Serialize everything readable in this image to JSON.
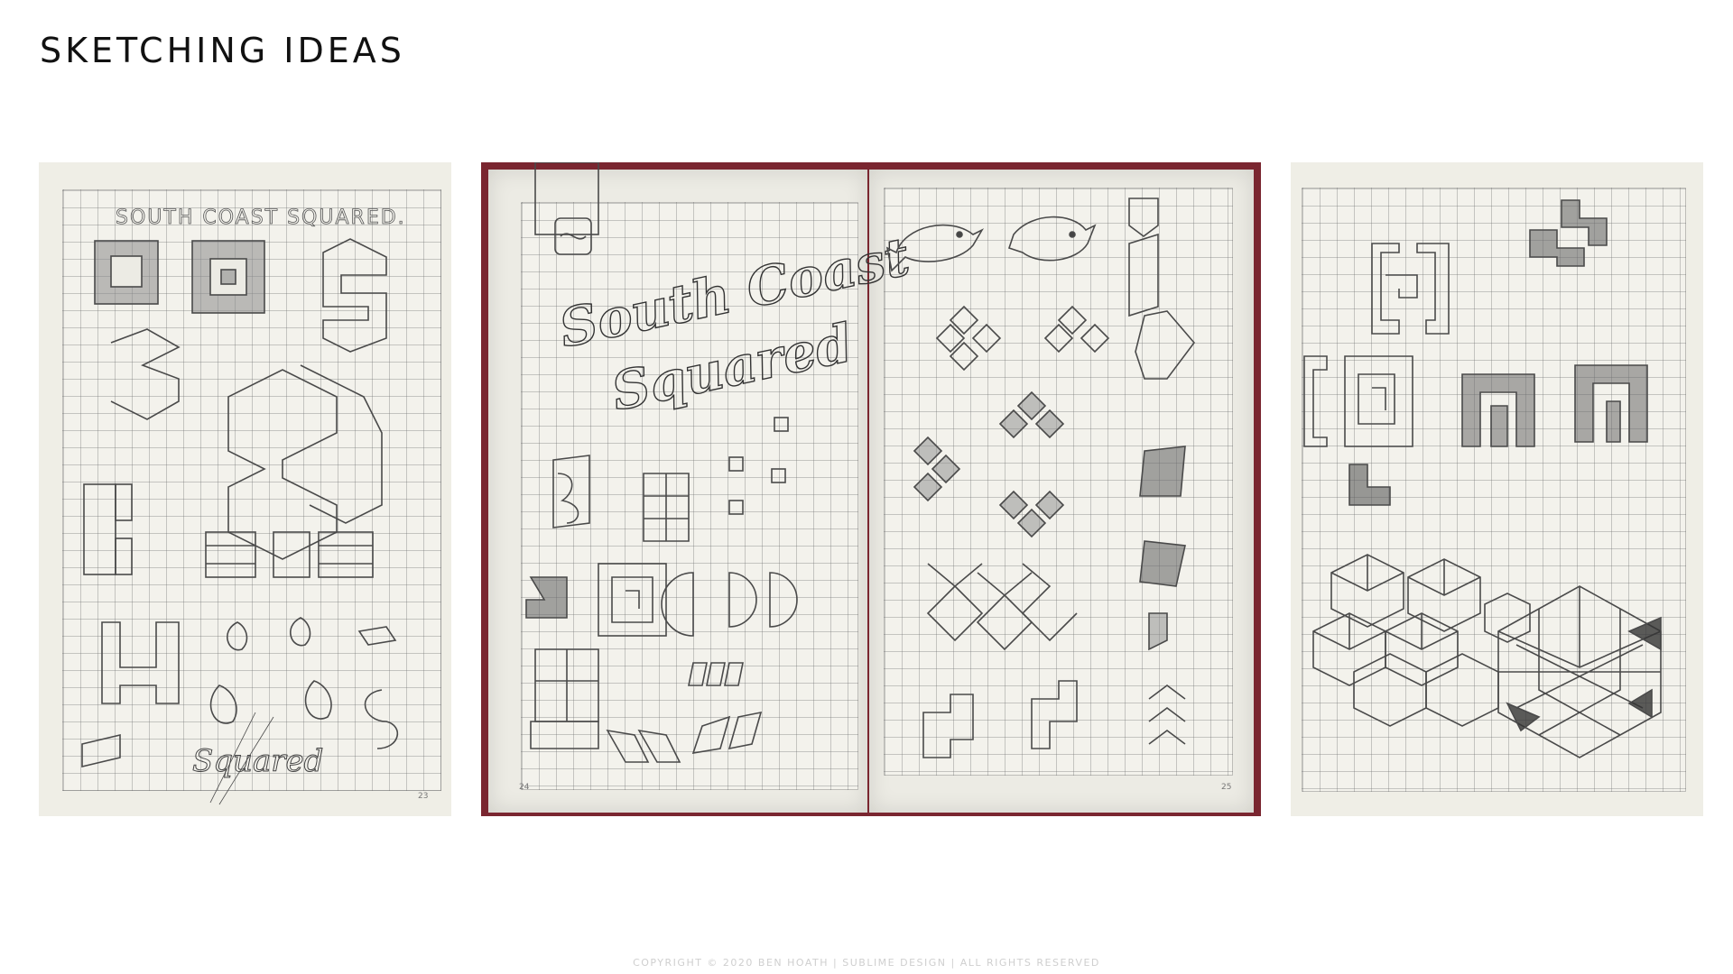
{
  "title": "SKETCHING IDEAS",
  "footer": "COPYRIGHT © 2020 BEN HOATH | SUBLIME DESIGN | ALL RIGHTS RESERVED",
  "sketches": {
    "left": {
      "heading": "SOUTH COAST SQUARED.",
      "script_word": "Squared",
      "page_number": "23"
    },
    "center": {
      "script_line1": "South Coast",
      "script_line2": "Squared",
      "page_left": "24",
      "page_right": "25"
    },
    "right": {}
  }
}
